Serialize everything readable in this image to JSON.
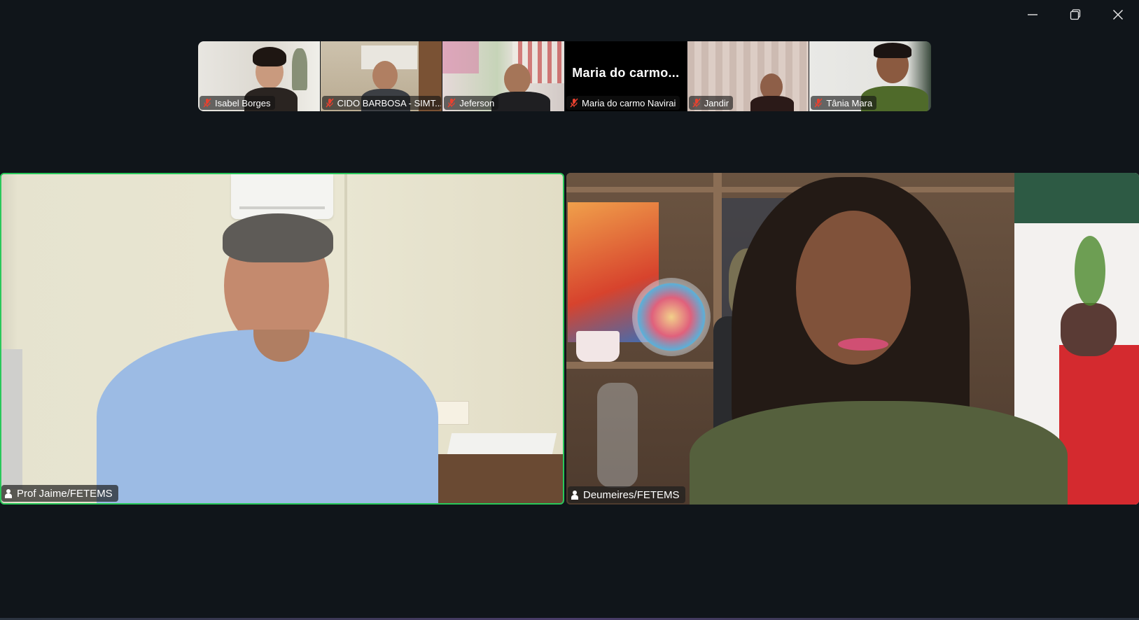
{
  "window": {
    "controls": {
      "minimize": "minimize-icon",
      "restore": "restore-icon",
      "close": "close-icon"
    }
  },
  "filmstrip": {
    "participants": [
      {
        "name": "Isabel Borges",
        "muted": true
      },
      {
        "name": "CIDO BARBOSA - SIMT...",
        "muted": true
      },
      {
        "name": "Jeferson",
        "muted": true
      },
      {
        "name": "Maria do carmo Navirai",
        "display_name": "Maria  do  carmo...",
        "muted": true,
        "video": false
      },
      {
        "name": "Jandir",
        "muted": true
      },
      {
        "name": "Tânia Mara",
        "muted": true
      }
    ]
  },
  "main": {
    "speakers": [
      {
        "name": "Prof Jaime/FETEMS",
        "active_speaker": true
      },
      {
        "name": "Deumeires/FETEMS",
        "active_speaker": false
      }
    ]
  },
  "colors": {
    "background": "#10151a",
    "active_speaker_border": "#29c85a",
    "muted_icon": "#e8412f"
  }
}
